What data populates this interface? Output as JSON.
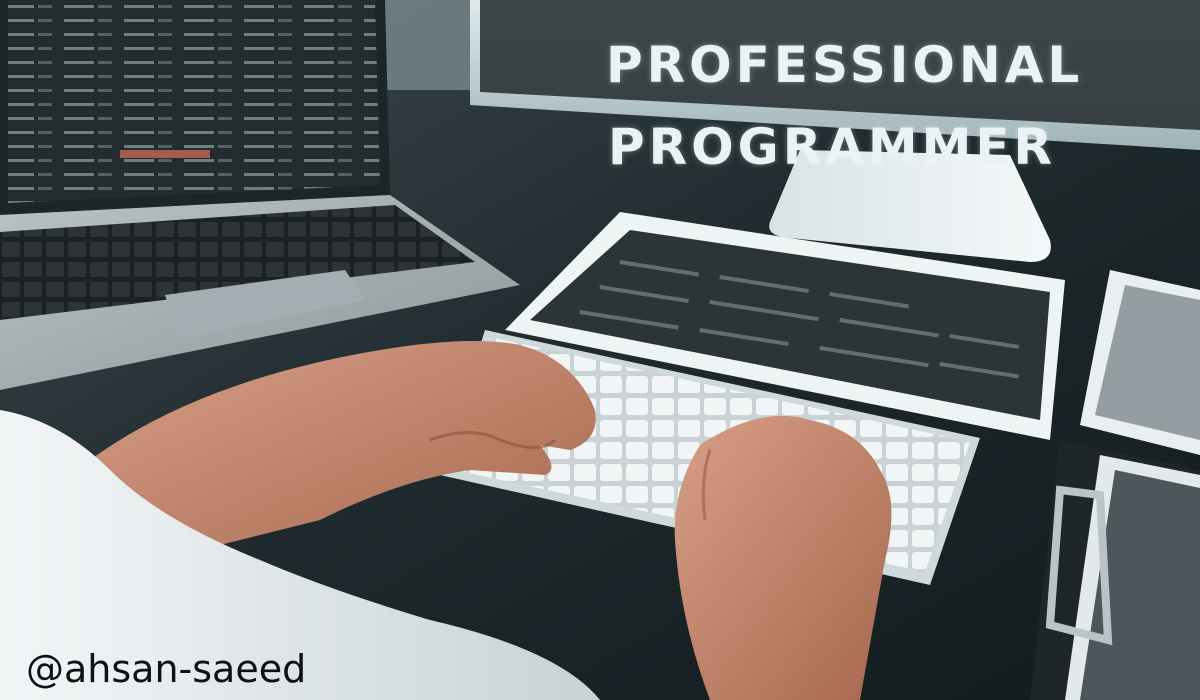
{
  "headline": {
    "line1": "PROFESSIONAL",
    "line2": "PROGRAMMER"
  },
  "handle": "@ahsan-saeed"
}
